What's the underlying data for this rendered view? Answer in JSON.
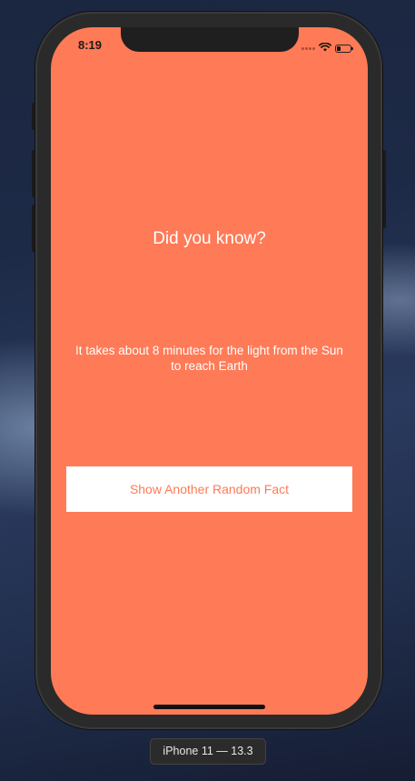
{
  "colors": {
    "screen_background": "#FF7A56",
    "button_background": "#FFFFFF",
    "button_text": "#FF7A56",
    "text": "#FFFFFF"
  },
  "status_bar": {
    "time": "8:19",
    "icons": [
      "signal-icon",
      "wifi-icon",
      "battery-icon"
    ]
  },
  "main": {
    "headline": "Did you know?",
    "fact": "It takes about 8 minutes for the light from the Sun to reach Earth",
    "button_label": "Show Another Random Fact"
  },
  "simulator": {
    "device_label": "iPhone 11 — 13.3"
  }
}
